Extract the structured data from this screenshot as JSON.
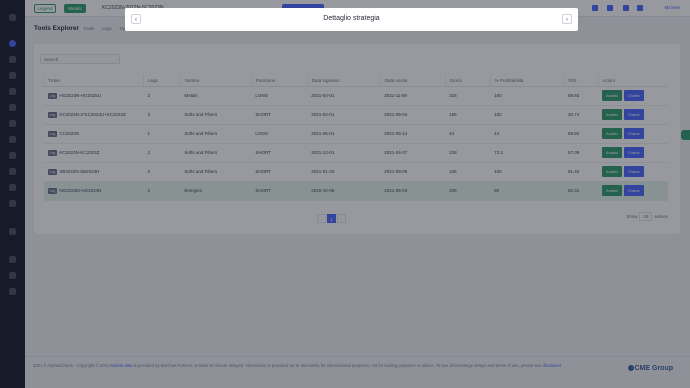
{
  "topbar": {
    "btn_outline": "Legend",
    "btn_filled": "Metals",
    "ticker": "KC2023N-2022N-SC2023N",
    "user": "Michele"
  },
  "page": {
    "title": "Tools Explorer",
    "filters": [
      "Trade",
      "Legs",
      "Tipo"
    ]
  },
  "search": {
    "placeholder": "Search"
  },
  "table": {
    "headers": [
      "Ticker",
      "Legs",
      "Settore",
      "Posizione",
      "Data ingresso",
      "Data uscita",
      "Giorni",
      "% Profittabilità",
      "ROI",
      "Azioni"
    ],
    "rows": [
      {
        "badge": "Leg",
        "ticker": "HG2023N-HG2025U",
        "legs": "2",
        "settore": "Metals",
        "posizione": "LONG",
        "ingresso": "2021-04-01",
        "uscita": "2021-11-09",
        "giorni": "316",
        "profit": "100",
        "roi": "58.93",
        "analisi": "Analisi",
        "charts": "Charts"
      },
      {
        "badge": "Leg",
        "ticker": "KC2023N-2*KC2023U+KC2023Z",
        "legs": "3",
        "settore": "Softs and Fibers",
        "posizione": "SHORT",
        "ingresso": "2021-04-01",
        "uscita": "2021-09-04",
        "giorni": "156",
        "profit": "100",
        "roi": "40.74",
        "analisi": "Analisi",
        "charts": "Charts"
      },
      {
        "badge": "Leg",
        "ticker": "CC2023N",
        "legs": "1",
        "settore": "Softs and Fibers",
        "posizione": "LONG",
        "ingresso": "2021-05-01",
        "uscita": "2021-06-14",
        "giorni": "44",
        "profit": "44",
        "roi": "68.82",
        "analisi": "Analisi",
        "charts": "Charts"
      },
      {
        "badge": "Leg",
        "ticker": "KC2023N-KC2023Z",
        "legs": "2",
        "settore": "Softs and Fibers",
        "posizione": "SHORT",
        "ingresso": "2021-12-01",
        "uscita": "2021-04-07",
        "giorni": "228",
        "profit": "73.3",
        "roi": "57.09",
        "analisi": "Analisi",
        "charts": "Charts"
      },
      {
        "badge": "Leg",
        "ticker": "SB2023N-SB2023H",
        "legs": "2",
        "settore": "Softs and Fibers",
        "posizione": "SHORT",
        "ingresso": "2021-01-20",
        "uscita": "2021-08-06",
        "giorni": "106",
        "profit": "100",
        "roi": "61.45",
        "analisi": "Analisi",
        "charts": "Charts"
      },
      {
        "badge": "Leg",
        "ticker": "NG2023M-NG2024N",
        "legs": "2",
        "settore": "Energies",
        "posizione": "SHORT",
        "ingresso": "2020-10-05",
        "uscita": "2021-05-03",
        "giorni": "209",
        "profit": "80",
        "roi": "82.31",
        "analisi": "Analisi",
        "charts": "Charts"
      }
    ]
  },
  "pagination": {
    "prev": "‹",
    "current": "1",
    "next": "›",
    "show_label": "Show",
    "show_value": "25",
    "entries_label": "entries"
  },
  "footer": {
    "text_a": "2021 © Alpha4Charts · Copyright © 2021",
    "link1": "Market data",
    "text_b": "is provided by Barchart Futures: at least 10 minute delayed. Information is provided 'as-is' and solely for informational purposes, not for trading purposes or advice. To see all exchange delays and terms of use, please see",
    "link2": "disclaimer",
    "brand": "CME Group"
  },
  "modal": {
    "title": "Dettaglio strategia",
    "prev": "‹",
    "next": "›"
  }
}
